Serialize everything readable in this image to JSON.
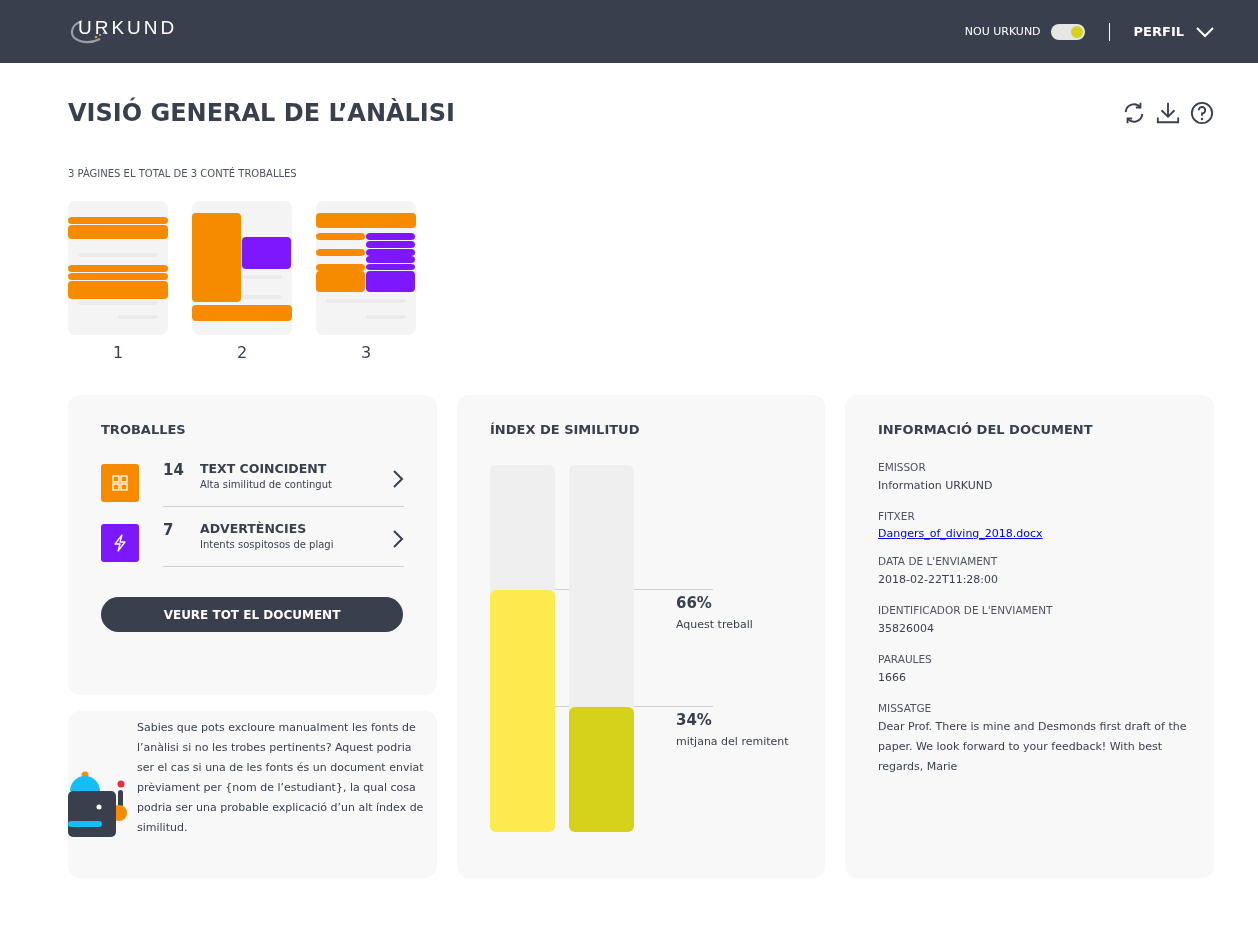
{
  "header": {
    "logo": "URKUND",
    "toggle": {
      "label": "NOU URKUND",
      "on": true
    },
    "profile": "PERFIL"
  },
  "title": "VISIÓ GENERAL DE L’ANÀLISI",
  "pages": {
    "summary": "3 PÀGINES EL TOTAL DE 3 CONTÉ TROBALLES",
    "items": [
      {
        "label": "1"
      },
      {
        "label": "2"
      },
      {
        "label": "3"
      }
    ]
  },
  "findings": {
    "title": "TROBALLES",
    "items": [
      {
        "kind": "matching",
        "color": "#f68b00",
        "count": "14",
        "name": "TEXT COINCIDENT",
        "description": "Alta similitud de contingut"
      },
      {
        "kind": "warning",
        "color": "#7d17fe",
        "count": "7",
        "name": "ADVERTÈNCIES",
        "description": "Intents sospitosos de plagi"
      }
    ],
    "button": "VEURE TOT EL DOCUMENT"
  },
  "tip": "Sabies que pots excloure manualment les fonts de l’anàlisi si no les trobes pertinents? Aquest podria ser el cas si una de les fonts és un document enviat prèviament per {nom de l’estudiant}, la qual cosa podria ser una probable explicació d’un alt índex de similitud.",
  "similarity": {
    "title": "ÍNDEX DE SIMILITUD",
    "bars": [
      {
        "color": "#fdea4f",
        "level": 0.66,
        "value": "66%",
        "label": "Aquest treball"
      },
      {
        "color": "#d6d11b",
        "level": 0.34,
        "value": "34%",
        "label": "mitjana del remitent"
      }
    ]
  },
  "document": {
    "title": "INFORMACIÓ DEL DOCUMENT",
    "fields": [
      {
        "label": "EMISSOR",
        "value": "Information URKUND"
      },
      {
        "kind": "link",
        "label": "FITXER",
        "value": "Dangers_of_diving_2018.docx"
      },
      {
        "label": "DATA DE L'ENVIAMENT",
        "value": "2018-02-22T11:28:00"
      },
      {
        "label": "IDENTIFICADOR DE L'ENVIAMENT",
        "value": "35826004"
      },
      {
        "label": "PARAULES",
        "value": "1666"
      },
      {
        "label": "MISSATGE",
        "value": "Dear Prof. There is mine and Desmonds first draft of the paper. We look forward to your feedback! With best regards, Marie"
      }
    ]
  }
}
